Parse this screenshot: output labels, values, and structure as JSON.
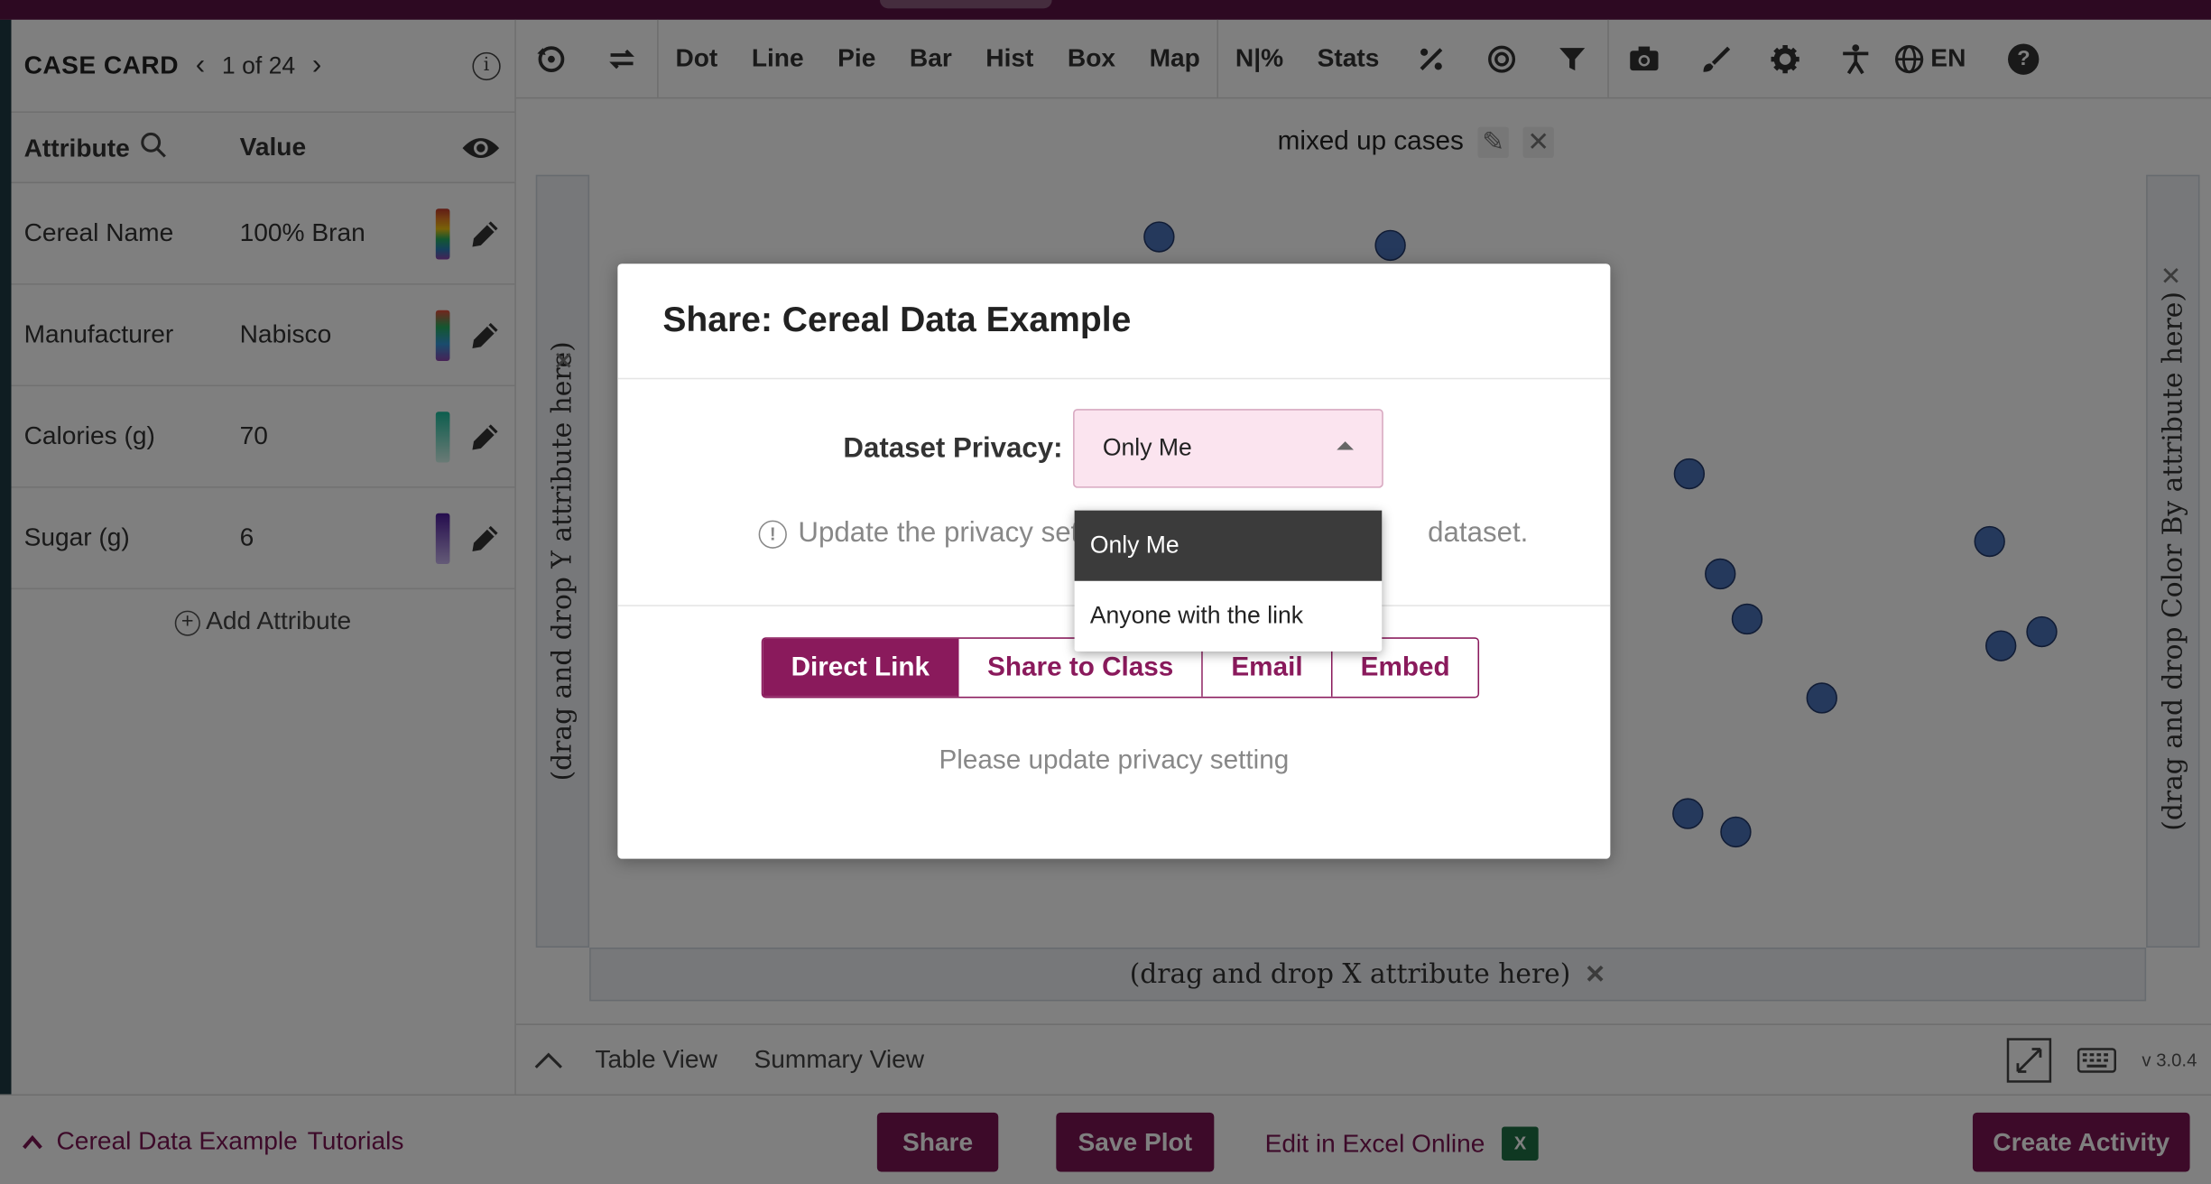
{
  "app": {
    "logo_fragment": ""
  },
  "case_card": {
    "title": "CASE CARD",
    "position": "1 of 24",
    "columns": {
      "attribute": "Attribute",
      "value": "Value"
    },
    "rows": [
      {
        "name": "Cereal Name",
        "value": "100% Bran",
        "swatch": "linear-gradient(#c0392b,#e67e22,#f1c40f,#27ae60,#2980b9,#8e44ad)"
      },
      {
        "name": "Manufacturer",
        "value": "Nabisco",
        "swatch": "linear-gradient(#e74c3c,#27ae60,#3498db,#8e44ad)"
      },
      {
        "name": "Calories (g)",
        "value": "70",
        "swatch": "linear-gradient(#1abc9c,#d5f5ec)"
      },
      {
        "name": "Sugar (g)",
        "value": "6",
        "swatch": "linear-gradient(#4b1a9c,#c9b6ef)"
      }
    ],
    "add_attribute": "Add Attribute"
  },
  "toolbar": {
    "plots": [
      "Dot",
      "Line",
      "Pie",
      "Bar",
      "Hist",
      "Box",
      "Map"
    ],
    "n_percent": "N|%",
    "stats": "Stats",
    "language": "EN"
  },
  "plot": {
    "title": "mixed up cases",
    "y_placeholder": "(drag and drop Y attribute here)",
    "x_placeholder": "(drag and drop X attribute here)",
    "color_placeholder": "(drag and drop Color By attribute here)",
    "point_color": "#4a72b8"
  },
  "view_tabs": {
    "table": "Table View",
    "summary": "Summary View",
    "version": "v 3.0.4"
  },
  "footer": {
    "dataset": "Cereal Data Example",
    "tutorials": "Tutorials",
    "share": "Share",
    "save_plot": "Save Plot",
    "edit_excel": "Edit in Excel Online",
    "create_activity": "Create Activity",
    "accent": "#7a1553"
  },
  "modal": {
    "title": "Share: Cereal Data Example",
    "privacy_label": "Dataset Privacy:",
    "privacy_value": "Only Me",
    "hint_left": "Update the privacy sett",
    "hint_right": "dataset.",
    "tabs": [
      "Direct Link",
      "Share to Class",
      "Email",
      "Embed"
    ],
    "message": "Please update privacy setting",
    "dropdown_options": [
      "Only Me",
      "Anyone with the link"
    ]
  }
}
